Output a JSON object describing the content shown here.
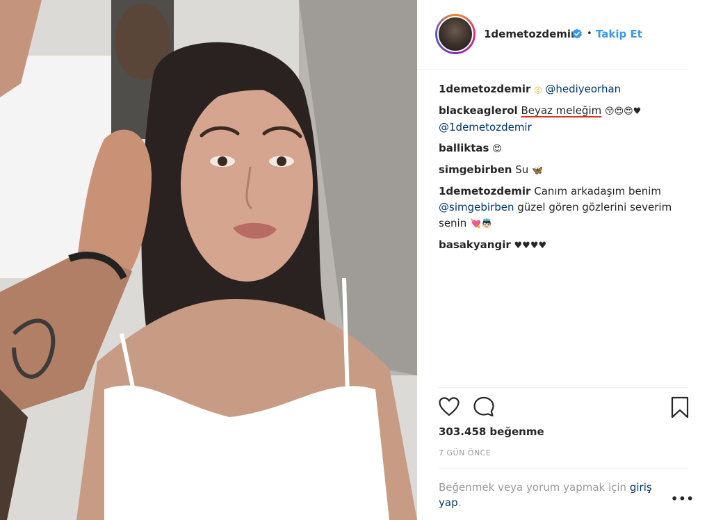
{
  "post": {
    "username": "1demetozdemir",
    "separator": "•",
    "follow_label": "Takip Et"
  },
  "comments": [
    {
      "user": "1demetozdemir",
      "emoji": "◎",
      "text": "@hediyeorhan"
    },
    {
      "user": "blackeaglerol",
      "text": "Beyaz meleğim",
      "emoji": "😚😍😍♥",
      "mention": "@1demetozdemir"
    },
    {
      "user": "balliktas",
      "emoji": "😍"
    },
    {
      "user": "simgebirben",
      "text": "Su",
      "emoji": "🦋"
    },
    {
      "user": "1demetozdemir",
      "text_1": "Canım arkadaşım benim",
      "mention": "@simgebirben",
      "text_2": "güzel gören gözlerini severim senin",
      "emoji": "💘👼🏻"
    },
    {
      "user": "basakyangir",
      "emoji": "♥♥♥♥"
    }
  ],
  "stats": {
    "likes_count": "303.458",
    "likes_label": "beğenme",
    "time": "7 GÜN ÖNCE"
  },
  "footer": {
    "prompt": "Beğenmek veya yorum yapmak için",
    "login_link_1": "giriş",
    "login_link_2": "yap",
    "period": ".",
    "more": "•••"
  },
  "icons": {
    "like": "heart-icon",
    "comment": "comment-bubble-icon",
    "save": "bookmark-icon",
    "verified": "verified-badge-icon"
  },
  "colors": {
    "link": "#3897f0",
    "mention": "#003569",
    "muted": "#999999",
    "text": "#262626",
    "verified": "#3897f0"
  }
}
